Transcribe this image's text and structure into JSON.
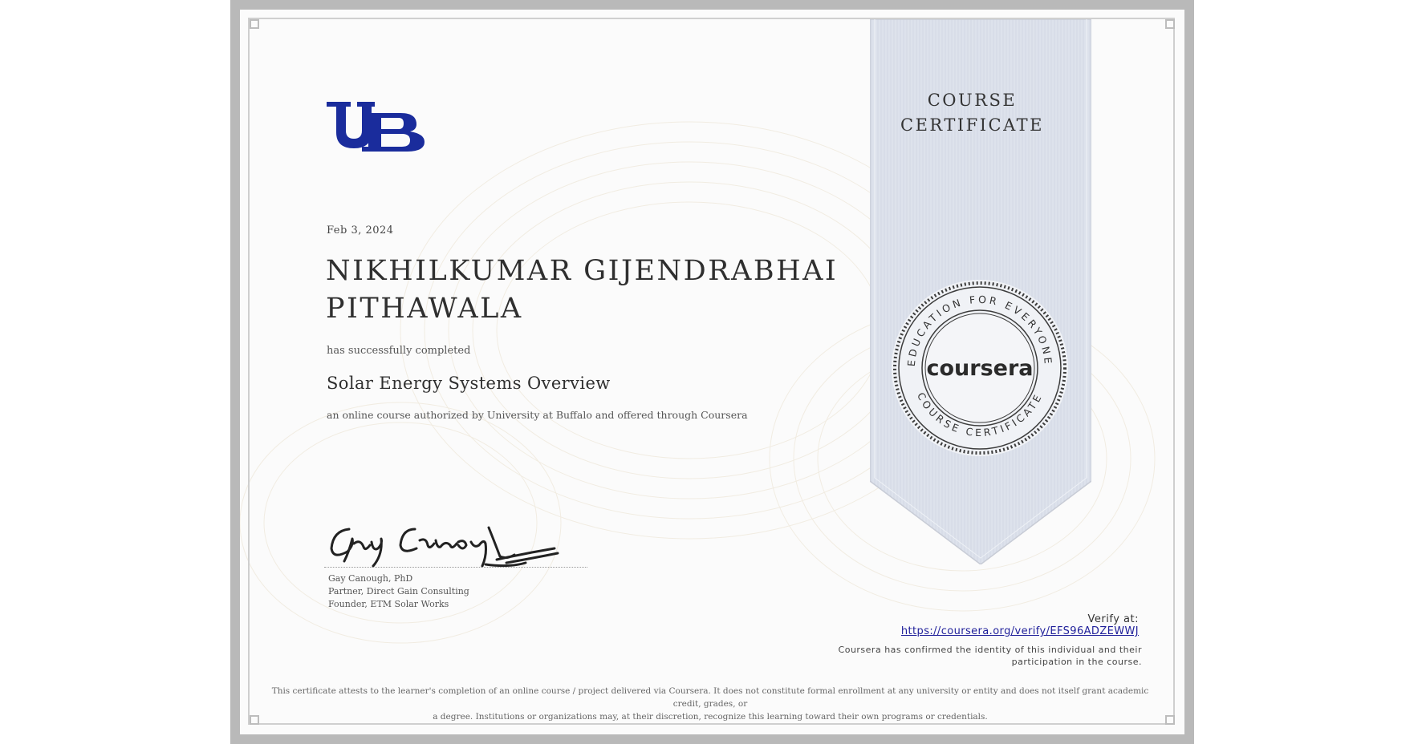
{
  "certificate": {
    "date": "Feb 3, 2024",
    "recipient_line1": "NIKHILKUMAR GIJENDRABHAI",
    "recipient_line2": "PITHAWALA",
    "completed_text": "has successfully completed",
    "course_title": "Solar Energy Systems Overview",
    "authorized_text": "an online course authorized by University at Buffalo and offered through Coursera"
  },
  "signer": {
    "name": "Gay Canough, PhD",
    "title1": "Partner, Direct Gain Consulting",
    "title2": "Founder, ETM Solar Works"
  },
  "ribbon": {
    "line1": "COURSE",
    "line2": "CERTIFICATE"
  },
  "seal": {
    "top_arc": "EDUCATION FOR EVERYONE",
    "bottom_arc": "COURSE CERTIFICATE",
    "brand": "coursera"
  },
  "verify": {
    "label": "Verify at:",
    "url": "https://coursera.org/verify/EFS96ADZEWWJ",
    "identity_line1": "Coursera has confirmed the identity of this individual and their",
    "identity_line2": "participation in the course."
  },
  "disclaimer": {
    "line1": "This certificate attests to the learner's completion of an online course / project delivered via Coursera. It does not constitute formal enrollment at any university or entity and does not itself grant academic credit, grades, or",
    "line2": "a degree. Institutions or organizations may, at their discretion, recognize this learning toward their own programs or credentials."
  },
  "colors": {
    "logo_blue": "#1a2c9c",
    "ribbon_fill": "#dde2ec",
    "link_blue": "#1f1f9a"
  },
  "icons": {
    "logo": "ub-logo",
    "seal": "coursera-seal",
    "signature": "handwritten-signature"
  }
}
